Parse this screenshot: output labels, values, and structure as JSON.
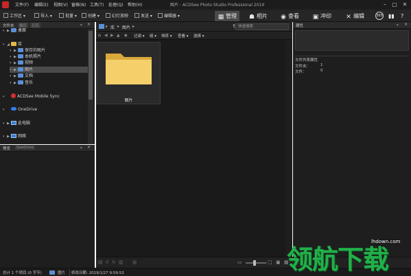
{
  "titlebar": {
    "menus": [
      "文件(F)",
      "编辑(E)",
      "视图(V)",
      "窗格(N)",
      "工具(T)",
      "处理(Q)",
      "帮助(H)"
    ],
    "window_title": "图片 - ACDSee Photo Studio Professional 2019"
  },
  "toolbar": {
    "items": [
      "工作区",
      "导入",
      "批量",
      "创建",
      "幻灯放映",
      "发送",
      "编辑器"
    ],
    "modes": [
      "管理",
      "相片",
      "查看",
      "冲印",
      "编辑"
    ],
    "stats_label": "365"
  },
  "folders_panel": {
    "tabs": [
      "文件夹",
      "编目",
      "日历"
    ],
    "items": [
      {
        "label": "桌面"
      },
      {
        "label": "库"
      },
      {
        "label": "保存的图片"
      },
      {
        "label": "本机照片"
      },
      {
        "label": "视频"
      },
      {
        "label": "图片"
      },
      {
        "label": "文档"
      },
      {
        "label": "音乐"
      },
      {
        "label": "ACDSee Mobile Sync"
      },
      {
        "label": "OneDrive"
      },
      {
        "label": "此电脑"
      },
      {
        "label": "网络"
      }
    ]
  },
  "preview_panel": {
    "tabs": [
      "预览",
      "SeeDrive"
    ]
  },
  "center": {
    "breadcrumb": [
      "库",
      "图片"
    ],
    "search_placeholder": "快速搜索",
    "filters": [
      "过滤",
      "组",
      "排序",
      "查看",
      "选择"
    ],
    "folder_label": "图片"
  },
  "properties_panel": {
    "title": "属性",
    "section_title": "文件列表属性",
    "rows": [
      {
        "label": "文件夹：",
        "value": "1"
      },
      {
        "label": "文件：",
        "value": "0"
      }
    ]
  },
  "status_bar": {
    "summary": "总计 1 个项目 (0 字节)",
    "folder": "图片",
    "modified": "修改日期: 2019/1/27 9:59:53"
  },
  "watermark": {
    "text": "领航下载",
    "url": "lhdown.com"
  },
  "colors": {
    "background": "#1e1e1e",
    "folder": "#e6b84a",
    "watermark": "#22b04a"
  }
}
